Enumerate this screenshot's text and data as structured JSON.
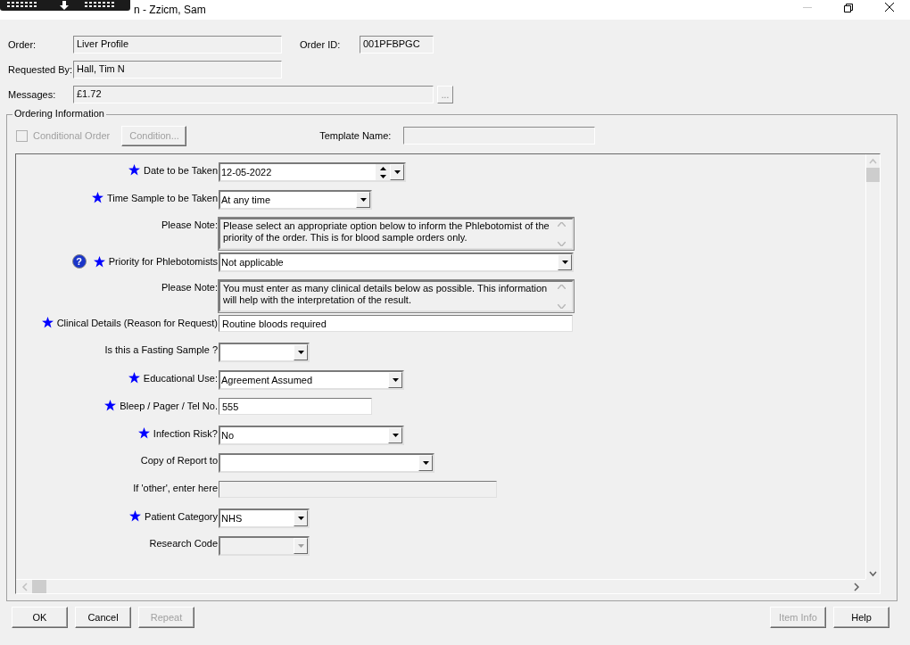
{
  "window": {
    "title": "n - Zzicm, Sam"
  },
  "order": {
    "label": "Order:",
    "value": "Liver Profile"
  },
  "order_id": {
    "label": "Order ID:",
    "value": "001PFBPGC"
  },
  "requested_by": {
    "label": "Requested By:",
    "value": "Hall, Tim N"
  },
  "messages": {
    "label": "Messages:",
    "value": "£1.72",
    "button": "..."
  },
  "ordering_information": {
    "title": "Ordering Information",
    "conditional_order": {
      "label": "Conditional Order",
      "checked": false,
      "disabled": true
    },
    "condition_button": {
      "label": "Condition...",
      "disabled": true
    },
    "template_name": {
      "label": "Template Name:"
    },
    "rows": [
      {
        "kind": "date",
        "label": "Date to be Taken",
        "required": true,
        "value": "12-05-2022",
        "disabled": false
      },
      {
        "kind": "dropdown",
        "label": "Time Sample to be Taken",
        "required": true,
        "value": "At any time",
        "disabled": false
      },
      {
        "kind": "note",
        "label": "Please Note:",
        "required": false,
        "value": "Please select an appropriate option below to inform the Phlebotomist of the priority of the order. This is for blood sample orders only.",
        "disabled": false
      },
      {
        "kind": "dropdown",
        "label": "Priority for Phlebotomists",
        "required": true,
        "help": "?",
        "value": "Not applicable",
        "disabled": false
      },
      {
        "kind": "note",
        "label": "Please Note:",
        "required": false,
        "value": "You must enter as many clinical details below as possible.  This information will help with the interpretation of the result.",
        "disabled": false
      },
      {
        "kind": "text",
        "label": "Clinical Details (Reason for Request)",
        "required": true,
        "value": "Routine bloods required",
        "disabled": false
      },
      {
        "kind": "dropdown",
        "label": "Is this a Fasting Sample ?",
        "required": false,
        "disabled": false
      },
      {
        "kind": "dropdown",
        "label": "Educational Use:",
        "required": true,
        "value": "Agreement Assumed",
        "disabled": false
      },
      {
        "kind": "text",
        "label": "Bleep / Pager / Tel No.",
        "required": true,
        "value": "555",
        "disabled": false
      },
      {
        "kind": "dropdown",
        "label": "Infection Risk?",
        "required": true,
        "value": "No",
        "disabled": false
      },
      {
        "kind": "dropdown",
        "label": "Copy of Report to",
        "required": false,
        "disabled": false
      },
      {
        "kind": "text",
        "label": "If 'other', enter here",
        "required": false,
        "disabled": true
      },
      {
        "kind": "dropdown",
        "label": "Patient Category",
        "required": true,
        "value": "NHS",
        "disabled": false
      },
      {
        "kind": "dropdown",
        "label": "Research Code",
        "required": false,
        "disabled": true
      }
    ]
  },
  "buttons_left": [
    {
      "label": "OK",
      "disabled": false
    },
    {
      "label": "Cancel",
      "disabled": false
    },
    {
      "label": "Repeat",
      "disabled": true
    }
  ],
  "buttons_right": [
    {
      "label": "Item Info",
      "disabled": true
    },
    {
      "label": "Help",
      "disabled": false
    }
  ]
}
